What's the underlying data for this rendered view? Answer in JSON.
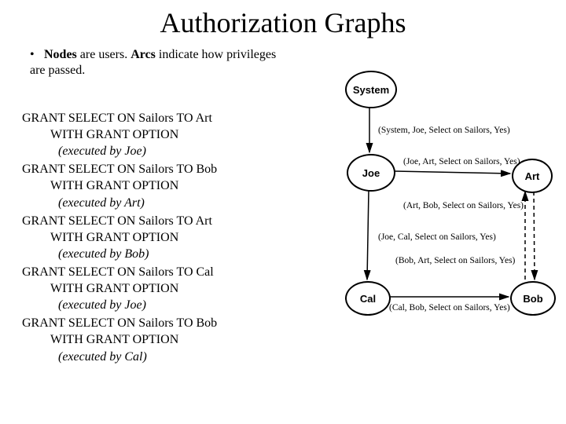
{
  "title": "Authorization Graphs",
  "bullet_bold1": "Nodes",
  "bullet_plain1": " are users. ",
  "bullet_bold2": "Arcs",
  "bullet_plain2": " indicate how privileges are passed.",
  "statements": [
    {
      "grant": "GRANT SELECT ON Sailors TO Art",
      "opt": "WITH GRANT OPTION",
      "exec": "(executed by Joe)"
    },
    {
      "grant": "GRANT SELECT ON Sailors TO Bob",
      "opt": "WITH GRANT OPTION",
      "exec": "(executed by Art)"
    },
    {
      "grant": "GRANT SELECT ON Sailors TO Art",
      "opt": "WITH GRANT OPTION",
      "exec": "(executed by Bob)"
    },
    {
      "grant": "GRANT SELECT ON Sailors TO Cal",
      "opt": "WITH GRANT OPTION",
      "exec": "(executed by Joe)"
    },
    {
      "grant": "GRANT SELECT ON Sailors TO Bob",
      "opt": "WITH GRANT OPTION",
      "exec": "(executed by Cal)"
    }
  ],
  "nodes": {
    "system": "System",
    "joe": "Joe",
    "art": "Art",
    "cal": "Cal",
    "bob": "Bob"
  },
  "edge_labels": {
    "sys_joe": "(System, Joe, Select on Sailors, Yes)",
    "joe_art": "(Joe, Art, Select on Sailors, Yes)",
    "art_bob": "(Art, Bob, Select on Sailors, Yes)",
    "joe_cal": "(Joe, Cal, Select on Sailors, Yes)",
    "bob_art": "(Bob, Art, Select on Sailors, Yes)",
    "cal_bob": "(Cal, Bob, Select on Sailors, Yes)"
  }
}
